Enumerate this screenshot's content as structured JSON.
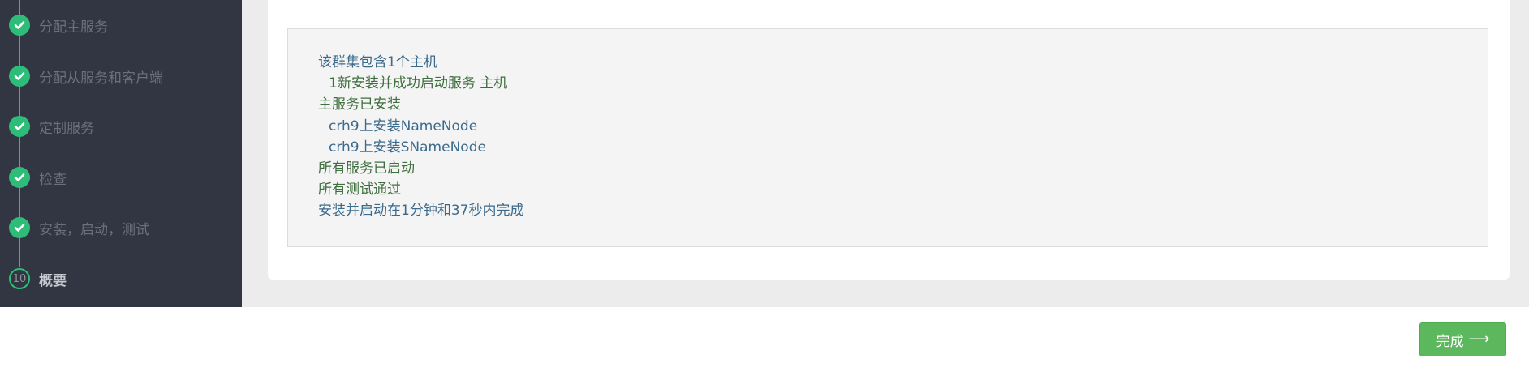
{
  "sidebar": {
    "steps": [
      {
        "label": "分配主服务",
        "status": "done",
        "icon": "check-icon"
      },
      {
        "label": "分配从服务和客户端",
        "status": "done",
        "icon": "check-icon"
      },
      {
        "label": "定制服务",
        "status": "done",
        "icon": "check-icon"
      },
      {
        "label": "检查",
        "status": "done",
        "icon": "check-icon"
      },
      {
        "label": "安装，启动，测试",
        "status": "done",
        "icon": "check-icon"
      },
      {
        "label": "概要",
        "status": "current",
        "number": "10"
      }
    ]
  },
  "summary": {
    "lines": [
      {
        "text": "该群集包含1个主机",
        "indent": false,
        "color": "#3b6a8c"
      },
      {
        "text": "1新安装并成功启动服务 主机",
        "indent": true,
        "color": "#3f6e3f"
      },
      {
        "text": "主服务已安装",
        "indent": false,
        "color": "#3f6e3f"
      },
      {
        "text": "crh9上安装NameNode",
        "indent": true,
        "color": "#3b6a8c"
      },
      {
        "text": "crh9上安装SNameNode",
        "indent": true,
        "color": "#3b6a8c"
      },
      {
        "text": "所有服务已启动",
        "indent": false,
        "color": "#3f6e3f"
      },
      {
        "text": "所有测试通过",
        "indent": false,
        "color": "#3f6e3f"
      },
      {
        "text": "安装并启动在1分钟和37秒内完成",
        "indent": false,
        "color": "#3b6a8c"
      }
    ]
  },
  "footer": {
    "finish_label": "完成",
    "finish_icon": "arrow-right-icon"
  },
  "colors": {
    "sidebar_bg": "#323642",
    "step_accent": "#2ebd78",
    "button_bg": "#5cb85c"
  }
}
